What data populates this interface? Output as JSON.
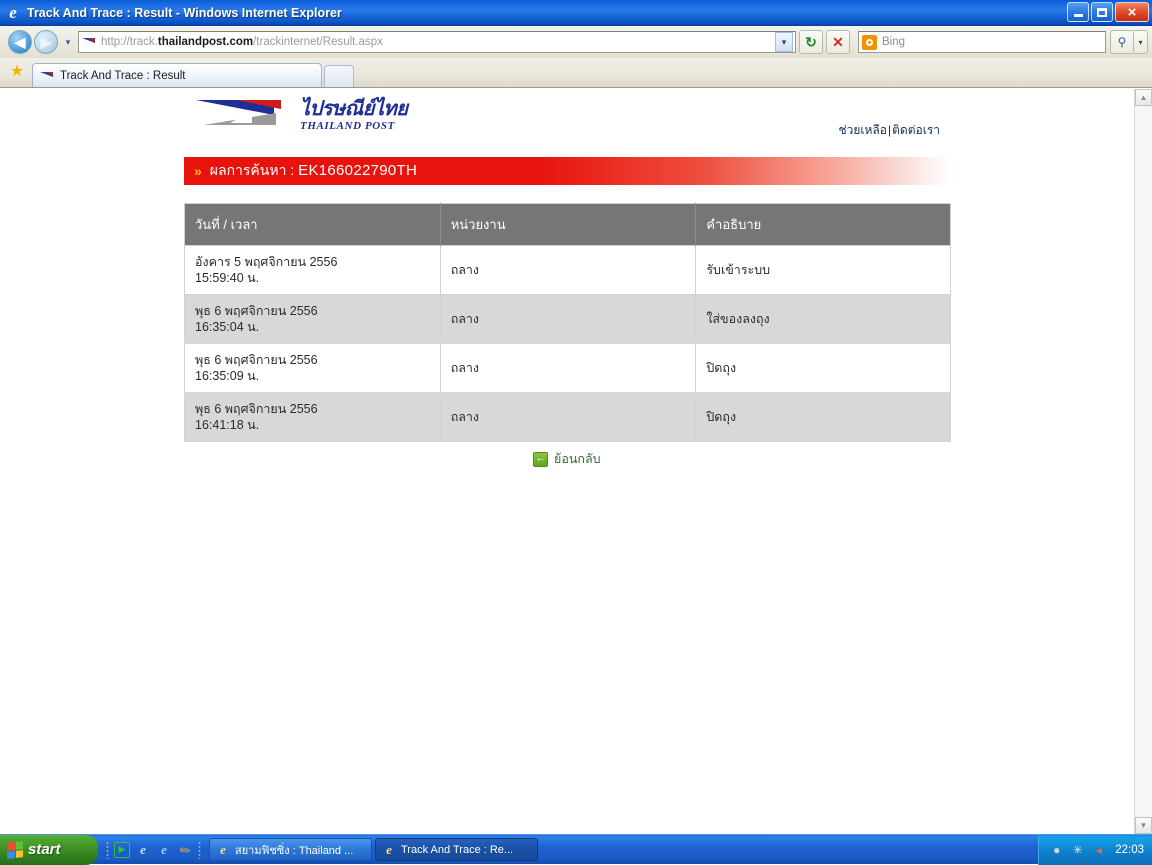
{
  "window": {
    "title": "Track And Trace : Result - Windows Internet Explorer",
    "ie_icon": "e",
    "minimize_label": "",
    "maximize_label": "",
    "close_label": "×"
  },
  "navbar": {
    "back_icon": "◀",
    "forward_icon": "▶",
    "history_caret": "▾",
    "url_protocol": "http://track.",
    "url_domain": "thailandpost.com",
    "url_path": "/trackinternet/Result.aspx",
    "url_full": "http://track.thailandpost.com/trackinternet/Result.aspx",
    "address_caret": "▾",
    "refresh_icon": "↻",
    "stop_icon": "✕",
    "search_provider": "Bing",
    "search_placeholder": "Bing",
    "search_go_icon": "⚲",
    "search_caret": "▾"
  },
  "tabs": {
    "favorites_icon": "★",
    "items": [
      {
        "label": "Track And Trace : Result",
        "favicon": "thailand-post-swoosh"
      }
    ],
    "new_tab_label": ""
  },
  "page": {
    "logo": {
      "thai_name": "ไปรษณีย์ไทย",
      "english_name": "THAILAND POST"
    },
    "header_links": {
      "help": "ช่วยเหลือ",
      "separator": "|",
      "contact": "ติดต่อเรา"
    },
    "banner": {
      "chevron": "»",
      "label": "ผลการค้นหา :",
      "tracking_number": "EK166022790TH",
      "color_start": "#e8130d",
      "color_end": "#ffffff",
      "chevron_color": "#f5c518"
    },
    "table": {
      "headers": [
        "วันที่ / เวลา",
        "หน่วยงาน",
        "คำอธิบาย"
      ],
      "header_bg": "#767676",
      "row_alt_bg": "#d8d8d8",
      "rows": [
        {
          "date": "อังคาร 5 พฤศจิกายน 2556",
          "time": "15:59:40 น.",
          "office": "ถลาง",
          "description": "รับเข้าระบบ"
        },
        {
          "date": "พุธ 6 พฤศจิกายน 2556",
          "time": "16:35:04 น.",
          "office": "ถลาง",
          "description": "ใส่ของลงถุง"
        },
        {
          "date": "พุธ 6 พฤศจิกายน 2556",
          "time": "16:35:09 น.",
          "office": "ถลาง",
          "description": "ปิดถุง"
        },
        {
          "date": "พุธ 6 พฤศจิกายน 2556",
          "time": "16:41:18 น.",
          "office": "ถลาง",
          "description": "ปิดถุง"
        }
      ]
    },
    "back_link": {
      "icon": "←",
      "label": "ย้อนกลับ"
    },
    "scrollbar": {
      "up_arrow": "▲",
      "down_arrow": "▼"
    }
  },
  "taskbar": {
    "start_label": "start",
    "quicklaunch": [
      {
        "name": "media-player-icon",
        "glyph": "▶"
      },
      {
        "name": "internet-explorer-icon",
        "glyph": "e"
      },
      {
        "name": "ie-shortcut-icon",
        "glyph": "e"
      },
      {
        "name": "pencil-icon",
        "glyph": "✎"
      }
    ],
    "tasks": [
      {
        "label": "สยามฟิชซิ่ง : Thailand ...",
        "active": false
      },
      {
        "label": "Track And Trace : Re...",
        "active": true
      }
    ],
    "tray": [
      {
        "name": "shield-icon",
        "glyph": "●"
      },
      {
        "name": "star-icon",
        "glyph": "✳"
      },
      {
        "name": "volume-icon",
        "glyph": "◂"
      }
    ],
    "clock": "22:03"
  }
}
